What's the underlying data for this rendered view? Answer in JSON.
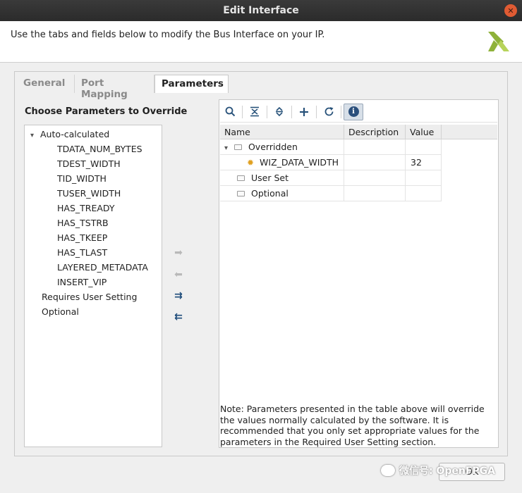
{
  "window": {
    "title": "Edit Interface"
  },
  "header": {
    "description": "Use the tabs and fields below to modify the Bus Interface on your IP."
  },
  "tabs": [
    {
      "label": "General",
      "active": false
    },
    {
      "label": "Port Mapping",
      "active": false
    },
    {
      "label": "Parameters",
      "active": true
    }
  ],
  "left_panel": {
    "title": "Choose Parameters to Override",
    "auto_group": "Auto-calculated",
    "auto_items": [
      "TDATA_NUM_BYTES",
      "TDEST_WIDTH",
      "TID_WIDTH",
      "TUSER_WIDTH",
      "HAS_TREADY",
      "HAS_TSTRB",
      "HAS_TKEEP",
      "HAS_TLAST",
      "LAYERED_METADATA",
      "INSERT_VIP"
    ],
    "requires_user": "Requires User Setting",
    "optional": "Optional"
  },
  "table": {
    "columns": [
      "Name",
      "Description",
      "Value"
    ],
    "rows": [
      {
        "name": "Overridden",
        "description": "",
        "value": ""
      },
      {
        "name": "WIZ_DATA_WIDTH",
        "description": "",
        "value": "32"
      },
      {
        "name": "User Set",
        "description": "",
        "value": ""
      },
      {
        "name": "Optional",
        "description": "",
        "value": ""
      }
    ]
  },
  "note": "Note: Parameters presented in the table above will override the values normally calculated by the software. It is recommended that you only set appropriate values for the parameters in the Required User Setting section.",
  "footer": {
    "ok_label": "OK",
    "watermark": "微信号: OpenFPGA"
  },
  "colors": {
    "accent": "#28527a",
    "gear": "#e0a020",
    "titlebar": "#2b2b2b",
    "close": "#e05b33"
  }
}
